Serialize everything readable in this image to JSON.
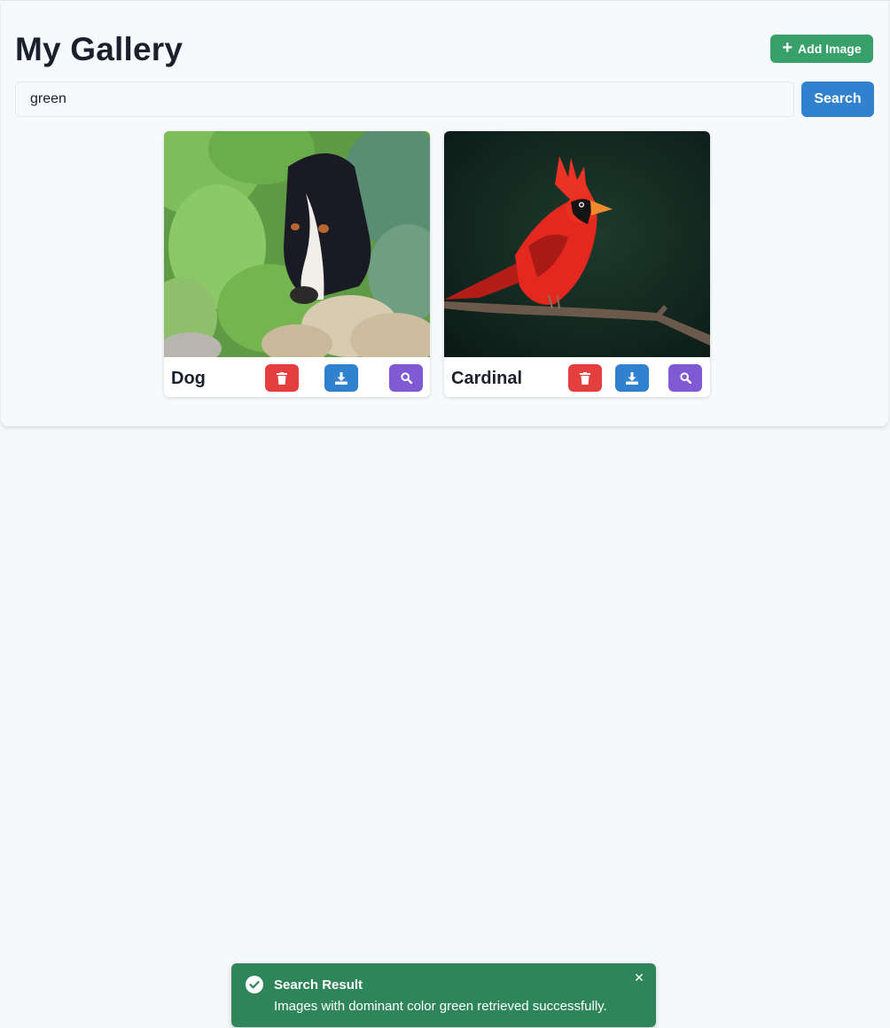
{
  "header": {
    "title": "My Gallery",
    "add_label": "Add Image"
  },
  "search": {
    "value": "green",
    "button_label": "Search"
  },
  "cards": [
    {
      "name": "Dog"
    },
    {
      "name": "Cardinal"
    }
  ],
  "toast": {
    "title": "Search Result",
    "message": "Images with dominant color green retrieved successfully.",
    "close_glyph": "✕"
  },
  "colors": {
    "accent_green": "#38a169",
    "accent_blue": "#3182ce",
    "delete_red": "#e53e3e",
    "zoom_purple": "#805ad5",
    "toast_green": "#2f855a"
  },
  "icons": {
    "add": "plus-icon",
    "delete": "trash-icon",
    "download": "download-icon",
    "view": "magnify-icon",
    "toast": "check-circle-icon",
    "close": "close-icon"
  }
}
